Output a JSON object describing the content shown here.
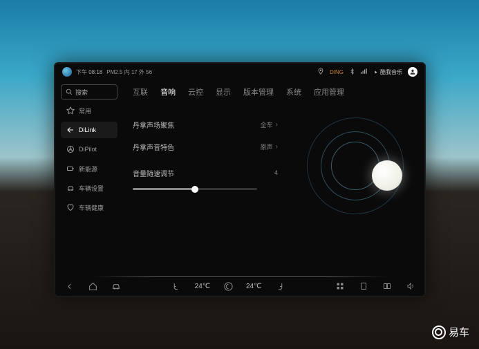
{
  "status": {
    "time": "下午 08:18",
    "pm": "PM2.5 内 17 外 56",
    "ding": "DING",
    "music": "酷我音乐"
  },
  "sidebar": {
    "search": "搜索",
    "items": [
      {
        "label": "常用"
      },
      {
        "label": "DiLink"
      },
      {
        "label": "DiPilot"
      },
      {
        "label": "新能源"
      },
      {
        "label": "车辆设置"
      },
      {
        "label": "车辆健康"
      }
    ]
  },
  "tabs": [
    "互联",
    "音响",
    "云控",
    "显示",
    "版本管理",
    "系统",
    "应用管理"
  ],
  "settings": {
    "focus": {
      "label": "丹拿声场聚焦",
      "value": "全车"
    },
    "tone": {
      "label": "丹拿声音特色",
      "value": "原声"
    },
    "volume": {
      "label": "音量随速调节",
      "value": "4",
      "percent": 50
    }
  },
  "bottombar": {
    "temp_left": "24℃",
    "temp_right": "24℃"
  },
  "watermark": "易车"
}
